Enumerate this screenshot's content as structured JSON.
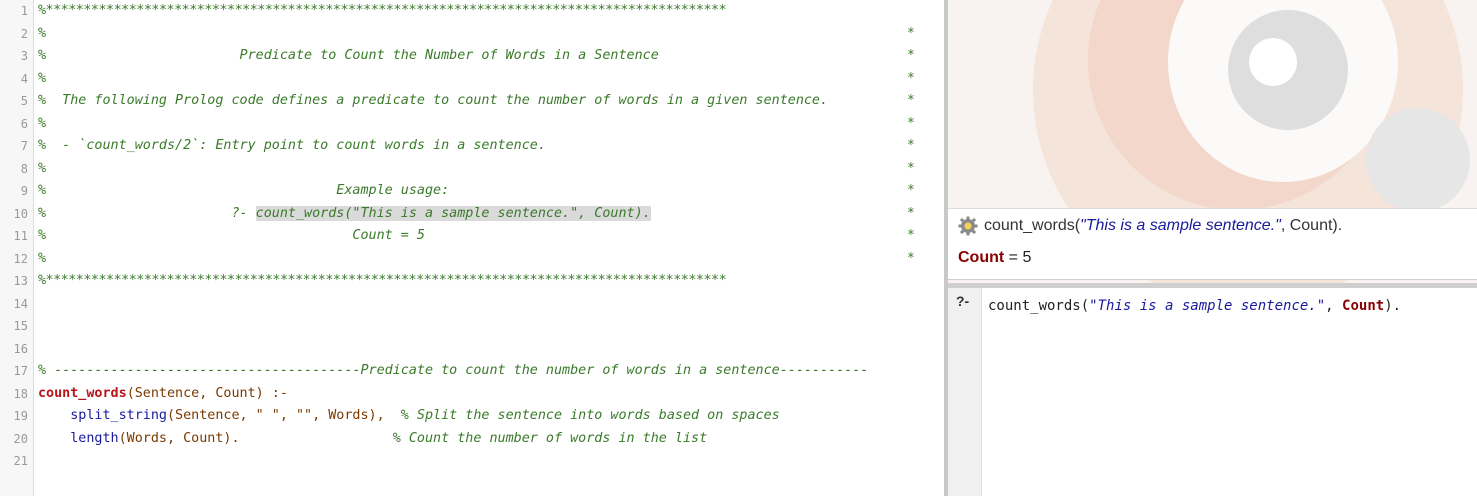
{
  "editor": {
    "lines": [
      {
        "n": "1",
        "kind": "stars",
        "text": "%******************************************************************************************"
      },
      {
        "n": "2",
        "kind": "comment",
        "text": "%",
        "right": "*"
      },
      {
        "n": "3",
        "kind": "comment",
        "text": "%                        Predicate to Count the Number of Words in a Sentence",
        "right": "*"
      },
      {
        "n": "4",
        "kind": "comment",
        "text": "%",
        "right": "*"
      },
      {
        "n": "5",
        "kind": "comment",
        "text": "%  The following Prolog code defines a predicate to count the number of words in a given sentence.",
        "right": "*"
      },
      {
        "n": "6",
        "kind": "comment",
        "text": "%",
        "right": "*"
      },
      {
        "n": "7",
        "kind": "comment",
        "text": "%  - `count_words/2`: Entry point to count words in a sentence.",
        "right": "*"
      },
      {
        "n": "8",
        "kind": "comment",
        "text": "%",
        "right": "*"
      },
      {
        "n": "9",
        "kind": "comment",
        "text": "%                                    Example usage:",
        "right": "*"
      },
      {
        "n": "10",
        "kind": "example",
        "prefix": "%                       ?- ",
        "highlight": "count_words(\"This is a sample sentence.\", Count).",
        "right": "*"
      },
      {
        "n": "11",
        "kind": "comment",
        "text": "%                                      Count = 5",
        "right": "*"
      },
      {
        "n": "12",
        "kind": "comment",
        "text": "%",
        "right": "*"
      },
      {
        "n": "13",
        "kind": "stars",
        "text": "%******************************************************************************************"
      },
      {
        "n": "14",
        "kind": "blank",
        "text": ""
      },
      {
        "n": "15",
        "kind": "blank",
        "text": ""
      },
      {
        "n": "16",
        "kind": "blank",
        "text": ""
      },
      {
        "n": "17",
        "kind": "comment",
        "text": "% --------------------------------------Predicate to count the number of words in a sentence-----------"
      },
      {
        "n": "18",
        "kind": "head",
        "fn": "count_words",
        "rest": "(Sentence, Count) :-"
      },
      {
        "n": "19",
        "kind": "body1",
        "call": "split_string",
        "args": "(Sentence, \" \", \"\", Words),",
        "cmt": "% Split the sentence into words based on spaces"
      },
      {
        "n": "20",
        "kind": "body2",
        "call": "length",
        "args": "(Words, Count).",
        "cmt": "% Count the number of words in the list"
      },
      {
        "n": "21",
        "kind": "blank",
        "text": ""
      }
    ]
  },
  "output": {
    "query_pre": "count_words(",
    "query_str": "\"This is a sample sentence.\"",
    "query_post": ", Count).",
    "answer_var": "Count",
    "answer_eq": " = 5"
  },
  "query_area": {
    "prompt": "?-",
    "input_pre": "count_words(",
    "input_str": "\"This is a sample sentence.\"",
    "input_mid": ", ",
    "input_var": "Count",
    "input_post": ")."
  },
  "icons": {
    "query_icon": "gear-icon"
  },
  "colors": {
    "comment": "#3a7a2a",
    "predicate": "#b8151b",
    "string": "#1a1a9c",
    "variable": "#8b0000"
  }
}
